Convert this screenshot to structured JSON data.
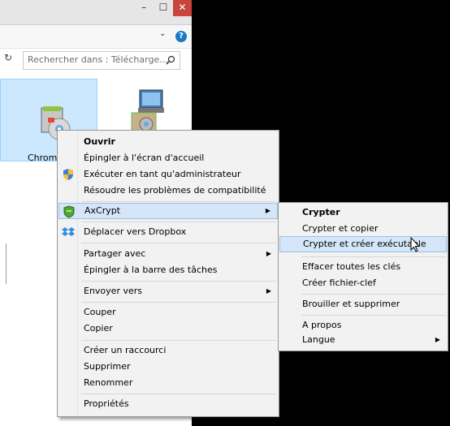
{
  "window": {
    "minimize_glyph": "–",
    "maximize_glyph": "☐",
    "close_glyph": "✕",
    "expand_glyph": "⌄",
    "help_glyph": "?",
    "refresh_glyph": "↻",
    "search_placeholder": "Rechercher dans : Télécharge...",
    "file_label": "Chrom"
  },
  "context_menu": {
    "items": [
      {
        "label": "Ouvrir"
      },
      {
        "label": "Épingler à l'écran d'accueil"
      },
      {
        "label": "Exécuter en tant qu'administrateur"
      },
      {
        "label": "Résoudre les problèmes de compatibilité"
      },
      {
        "label": "AxCrypt"
      },
      {
        "label": "Déplacer vers Dropbox"
      },
      {
        "label": "Partager avec"
      },
      {
        "label": "Épingler à la barre des tâches"
      },
      {
        "label": "Envoyer vers"
      },
      {
        "label": "Couper"
      },
      {
        "label": "Copier"
      },
      {
        "label": "Créer un raccourci"
      },
      {
        "label": "Supprimer"
      },
      {
        "label": "Renommer"
      },
      {
        "label": "Propriétés"
      }
    ]
  },
  "submenu": {
    "items": [
      {
        "label": "Crypter"
      },
      {
        "label": "Crypter et copier"
      },
      {
        "label": "Crypter et créer exécutable"
      },
      {
        "label": "Effacer toutes les clés"
      },
      {
        "label": "Créer fichier-clef"
      },
      {
        "label": "Brouiller et supprimer"
      },
      {
        "label": "A propos"
      },
      {
        "label": "Langue"
      }
    ]
  },
  "colors": {
    "close_button": "#c7453d",
    "selection": "#cce8ff",
    "menu_highlight": "#d4e6f8",
    "menu_background": "#f2f2f2",
    "background": "#000000"
  }
}
